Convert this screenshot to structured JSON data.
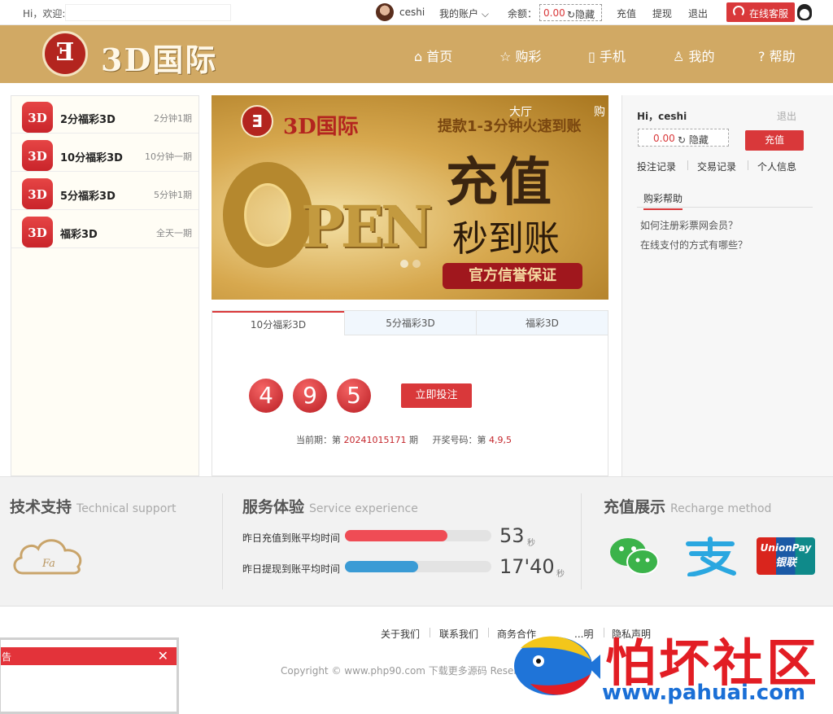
{
  "topbar": {
    "greeting": "Hi，欢迎:",
    "username": "ceshi",
    "account_menu": "我的账户",
    "balance_label": "余额：",
    "balance_value": "0.00",
    "hide_label": "隐藏",
    "recharge": "充值",
    "withdraw": "提现",
    "logout": "退出",
    "online_service": "在线客服"
  },
  "header": {
    "logo_mark": "Ǝ",
    "logo_text": "3D国际",
    "nav": [
      "首页",
      "购彩",
      "手机",
      "我的",
      "帮助"
    ]
  },
  "games": [
    {
      "icon_text": "3D",
      "name": "2分福彩3D",
      "desc": "2分钟1期"
    },
    {
      "icon_text": "3D",
      "name": "10分福彩3D",
      "desc": "10分钟一期"
    },
    {
      "icon_text": "3D",
      "name": "5分福彩3D",
      "desc": "5分钟1期"
    },
    {
      "icon_text": "3D",
      "name": "福彩3D",
      "desc": "全天一期"
    }
  ],
  "banner": {
    "brand": "3D国际",
    "tag1": "大厅",
    "tag2": "购",
    "subtitle": "提款1-3分钟火速到账",
    "big": "充值",
    "mid": "秒到账",
    "ribbon": "官方信誉保证",
    "open_text": "PEN"
  },
  "draw_tabs": [
    "10分福彩3D",
    "5分福彩3D",
    "福彩3D"
  ],
  "draw": {
    "balls": [
      "4",
      "9",
      "5"
    ],
    "bet_button": "立即投注",
    "period_prefix": "当前期：第",
    "period_value": "20241015171",
    "period_suffix": "期",
    "winning_prefix": "开奖号码：第",
    "winning_value": "4,9,5"
  },
  "user_panel": {
    "hi": "Hi，ceshi",
    "logout": "退出",
    "balance": "0.00",
    "hide": "隐藏",
    "recharge": "充值",
    "links": [
      "投注记录",
      "交易记录",
      "个人信息"
    ],
    "help_tab": "购彩帮助",
    "questions": [
      "如何注册彩票网会员？",
      "在线支付的方式有哪些？"
    ]
  },
  "support": {
    "title": "技术支持",
    "title_en": "Technical support"
  },
  "service": {
    "title": "服务体验",
    "title_en": "Service experience",
    "rows": [
      {
        "label": "昨日充值到账平均时间",
        "value": "53",
        "unit": "秒",
        "fill_percent": 70,
        "color": "#ef4c55"
      },
      {
        "label": "昨日提现到账平均时间",
        "value": "17'40",
        "unit": "秒",
        "fill_percent": 50,
        "color": "#3a9bd5"
      }
    ]
  },
  "recharge_methods": {
    "title": "充值展示",
    "title_en": "Recharge method",
    "unionpay_text": "UnionPay",
    "unionpay_cn": "银联"
  },
  "footer": {
    "links": [
      "关于我们",
      "联系我们",
      "商务合作",
      "...明",
      "隐私声明"
    ],
    "copyright": "Copyright © www.php90.com 下载更多源码 Reserved"
  },
  "popup": {
    "title": "告",
    "close": "✕"
  },
  "watermark": {
    "text": "怕坏社区",
    "url": "www.pahuai.com"
  }
}
